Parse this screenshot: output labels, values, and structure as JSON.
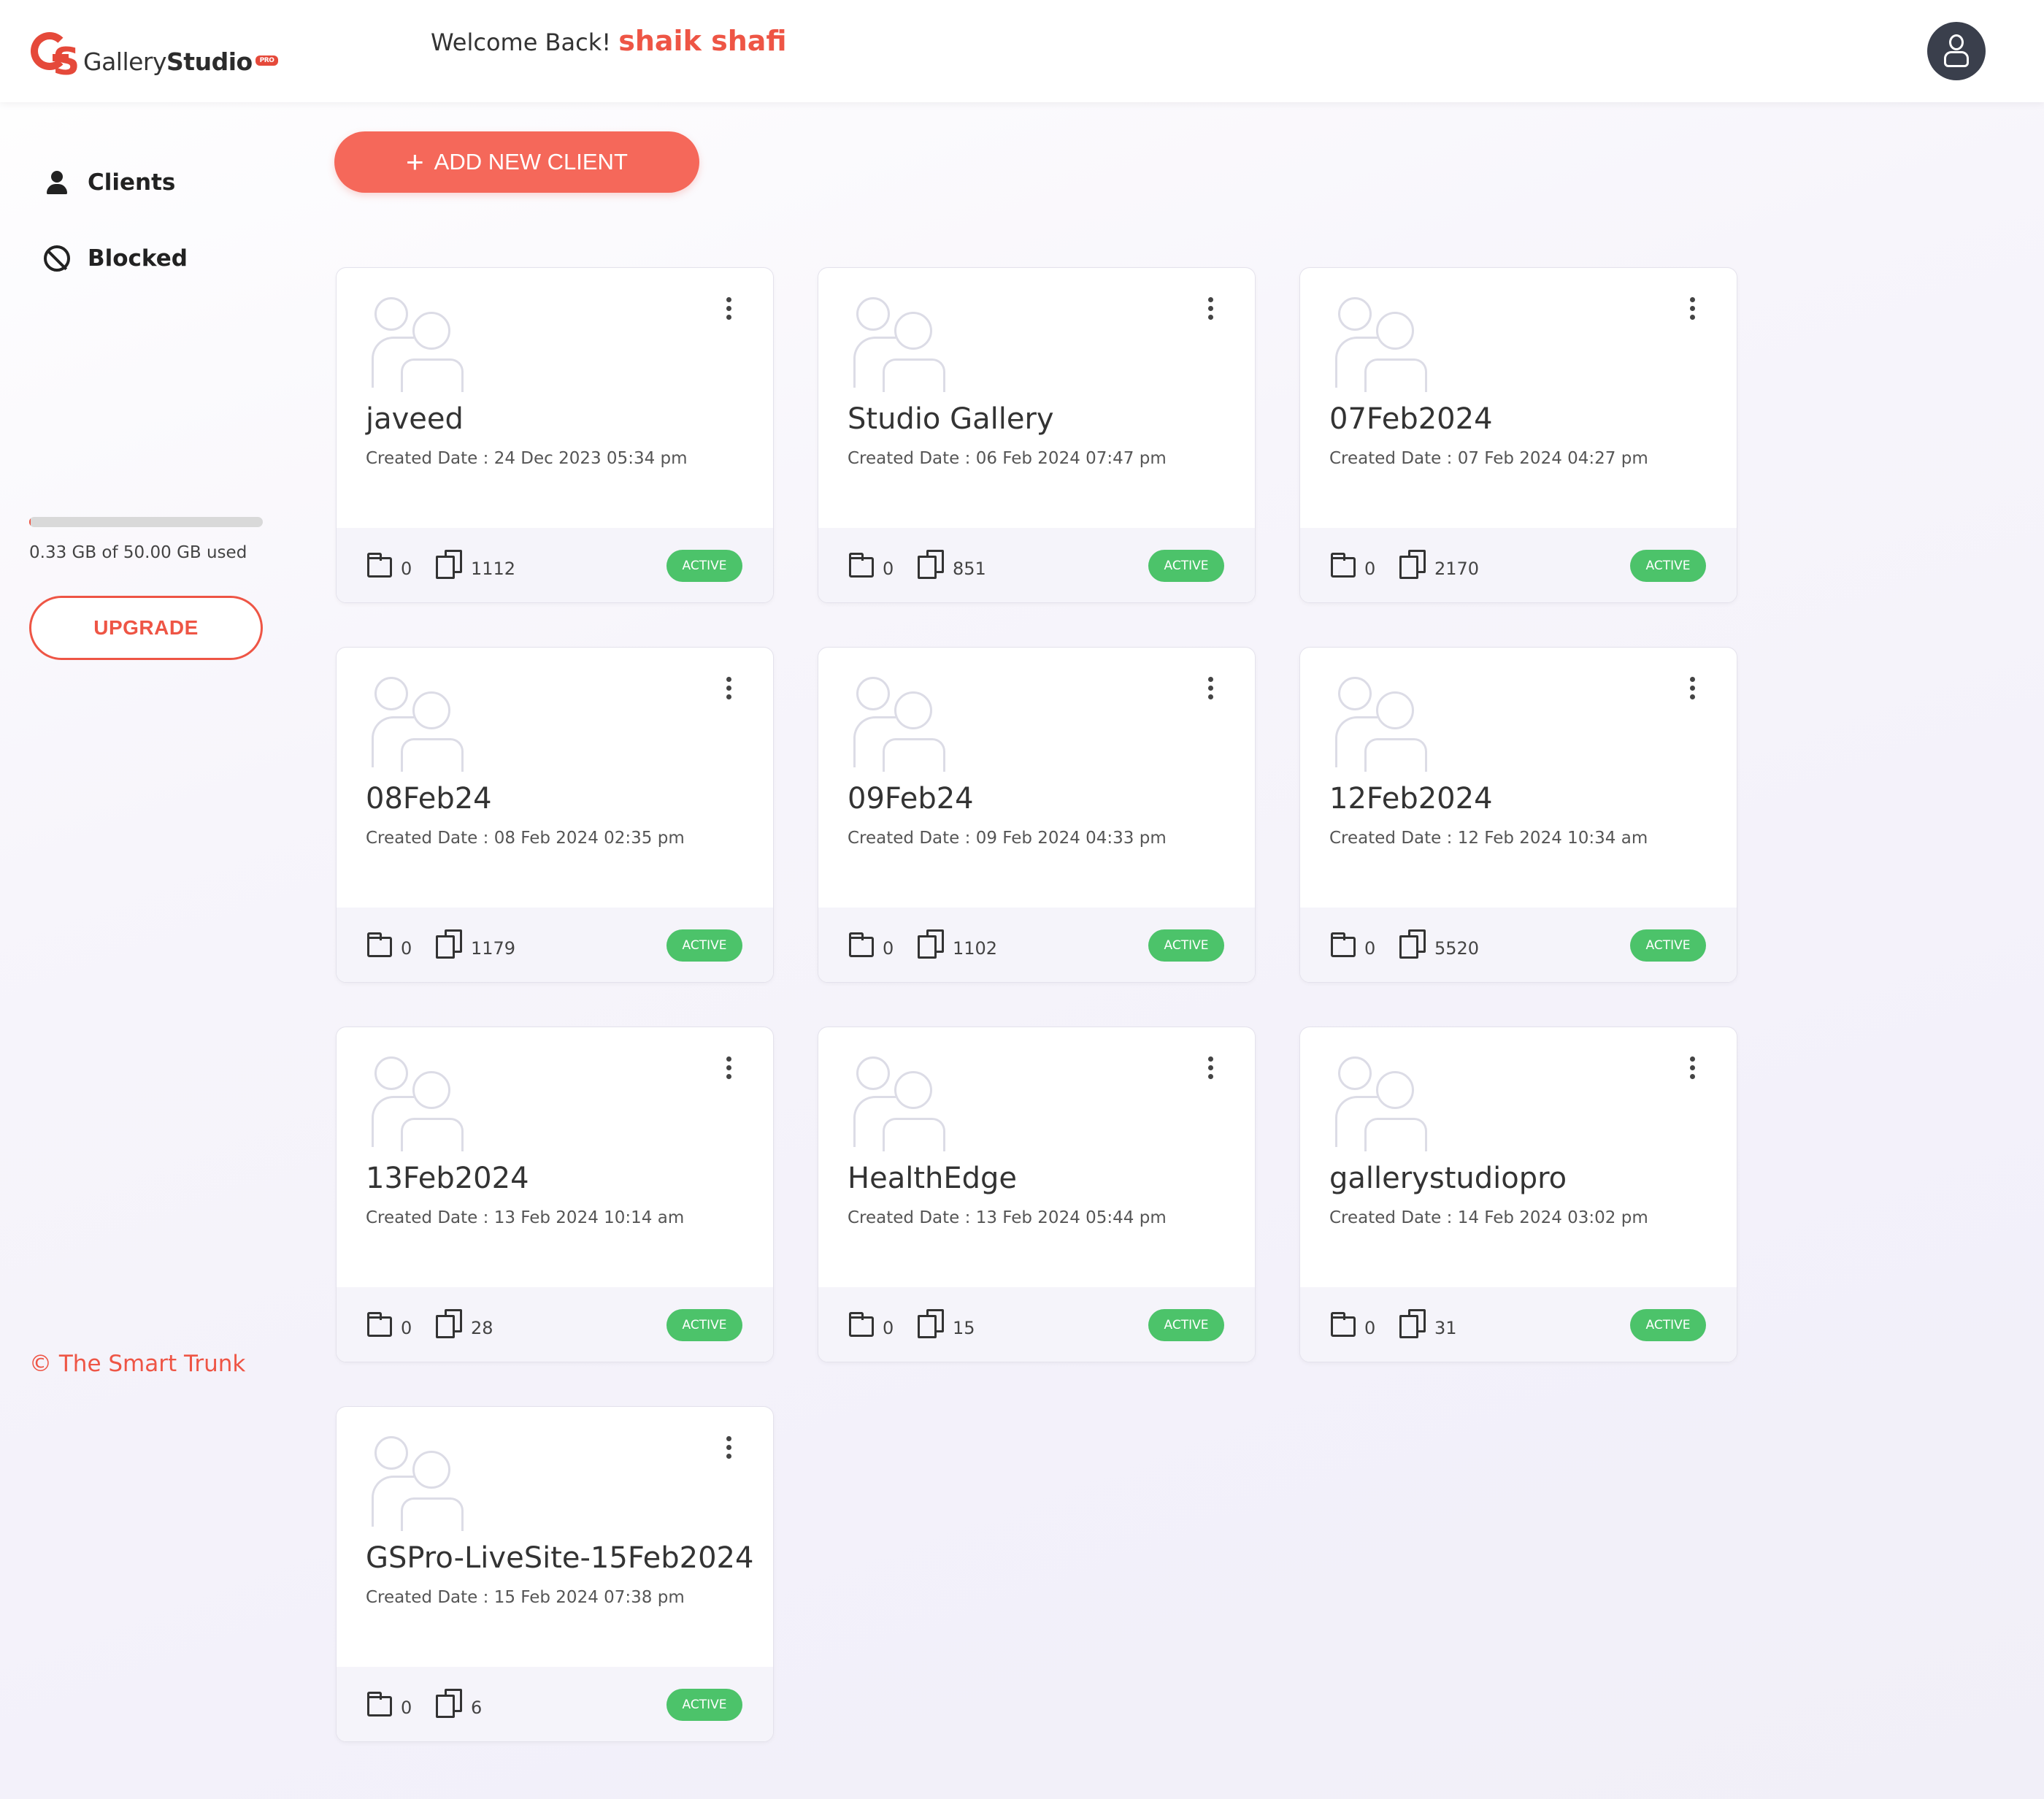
{
  "header": {
    "logo_text_light": "Gallery",
    "logo_text_bold": "Studio",
    "logo_badge": "PRO",
    "welcome_text": "Welcome Back!",
    "user_name": "shaik shafi"
  },
  "sidebar": {
    "items": [
      {
        "label": "Clients",
        "icon": "user-icon"
      },
      {
        "label": "Blocked",
        "icon": "block-icon"
      }
    ],
    "storage": {
      "used_fraction": 0.0066,
      "text": "0.33 GB of 50.00 GB used"
    },
    "upgrade_label": "UPGRADE",
    "copyright": "© The Smart Trunk"
  },
  "main": {
    "add_button_label": "ADD NEW CLIENT",
    "date_prefix": "Created Date : ",
    "clients": [
      {
        "name": "javeed",
        "created": "24 Dec 2023 05:34 pm",
        "folders": "0",
        "files": "1112",
        "status": "ACTIVE"
      },
      {
        "name": "Studio Gallery",
        "created": "06 Feb 2024 07:47 pm",
        "folders": "0",
        "files": "851",
        "status": "ACTIVE"
      },
      {
        "name": "07Feb2024",
        "created": "07 Feb 2024 04:27 pm",
        "folders": "0",
        "files": "2170",
        "status": "ACTIVE"
      },
      {
        "name": "08Feb24",
        "created": "08 Feb 2024 02:35 pm",
        "folders": "0",
        "files": "1179",
        "status": "ACTIVE"
      },
      {
        "name": "09Feb24",
        "created": "09 Feb 2024 04:33 pm",
        "folders": "0",
        "files": "1102",
        "status": "ACTIVE"
      },
      {
        "name": "12Feb2024",
        "created": "12 Feb 2024 10:34 am",
        "folders": "0",
        "files": "5520",
        "status": "ACTIVE"
      },
      {
        "name": "13Feb2024",
        "created": "13 Feb 2024 10:14 am",
        "folders": "0",
        "files": "28",
        "status": "ACTIVE"
      },
      {
        "name": "HealthEdge",
        "created": "13 Feb 2024 05:44 pm",
        "folders": "0",
        "files": "15",
        "status": "ACTIVE"
      },
      {
        "name": "gallerystudiopro",
        "created": "14 Feb 2024 03:02 pm",
        "folders": "0",
        "files": "31",
        "status": "ACTIVE"
      },
      {
        "name": "GSPro-LiveSite-15Feb2024",
        "created": "15 Feb 2024 07:38 pm",
        "folders": "0",
        "files": "6",
        "status": "ACTIVE"
      }
    ]
  },
  "colors": {
    "accent": "#ee5545",
    "button": "#f5685a",
    "active": "#4cc36a"
  }
}
